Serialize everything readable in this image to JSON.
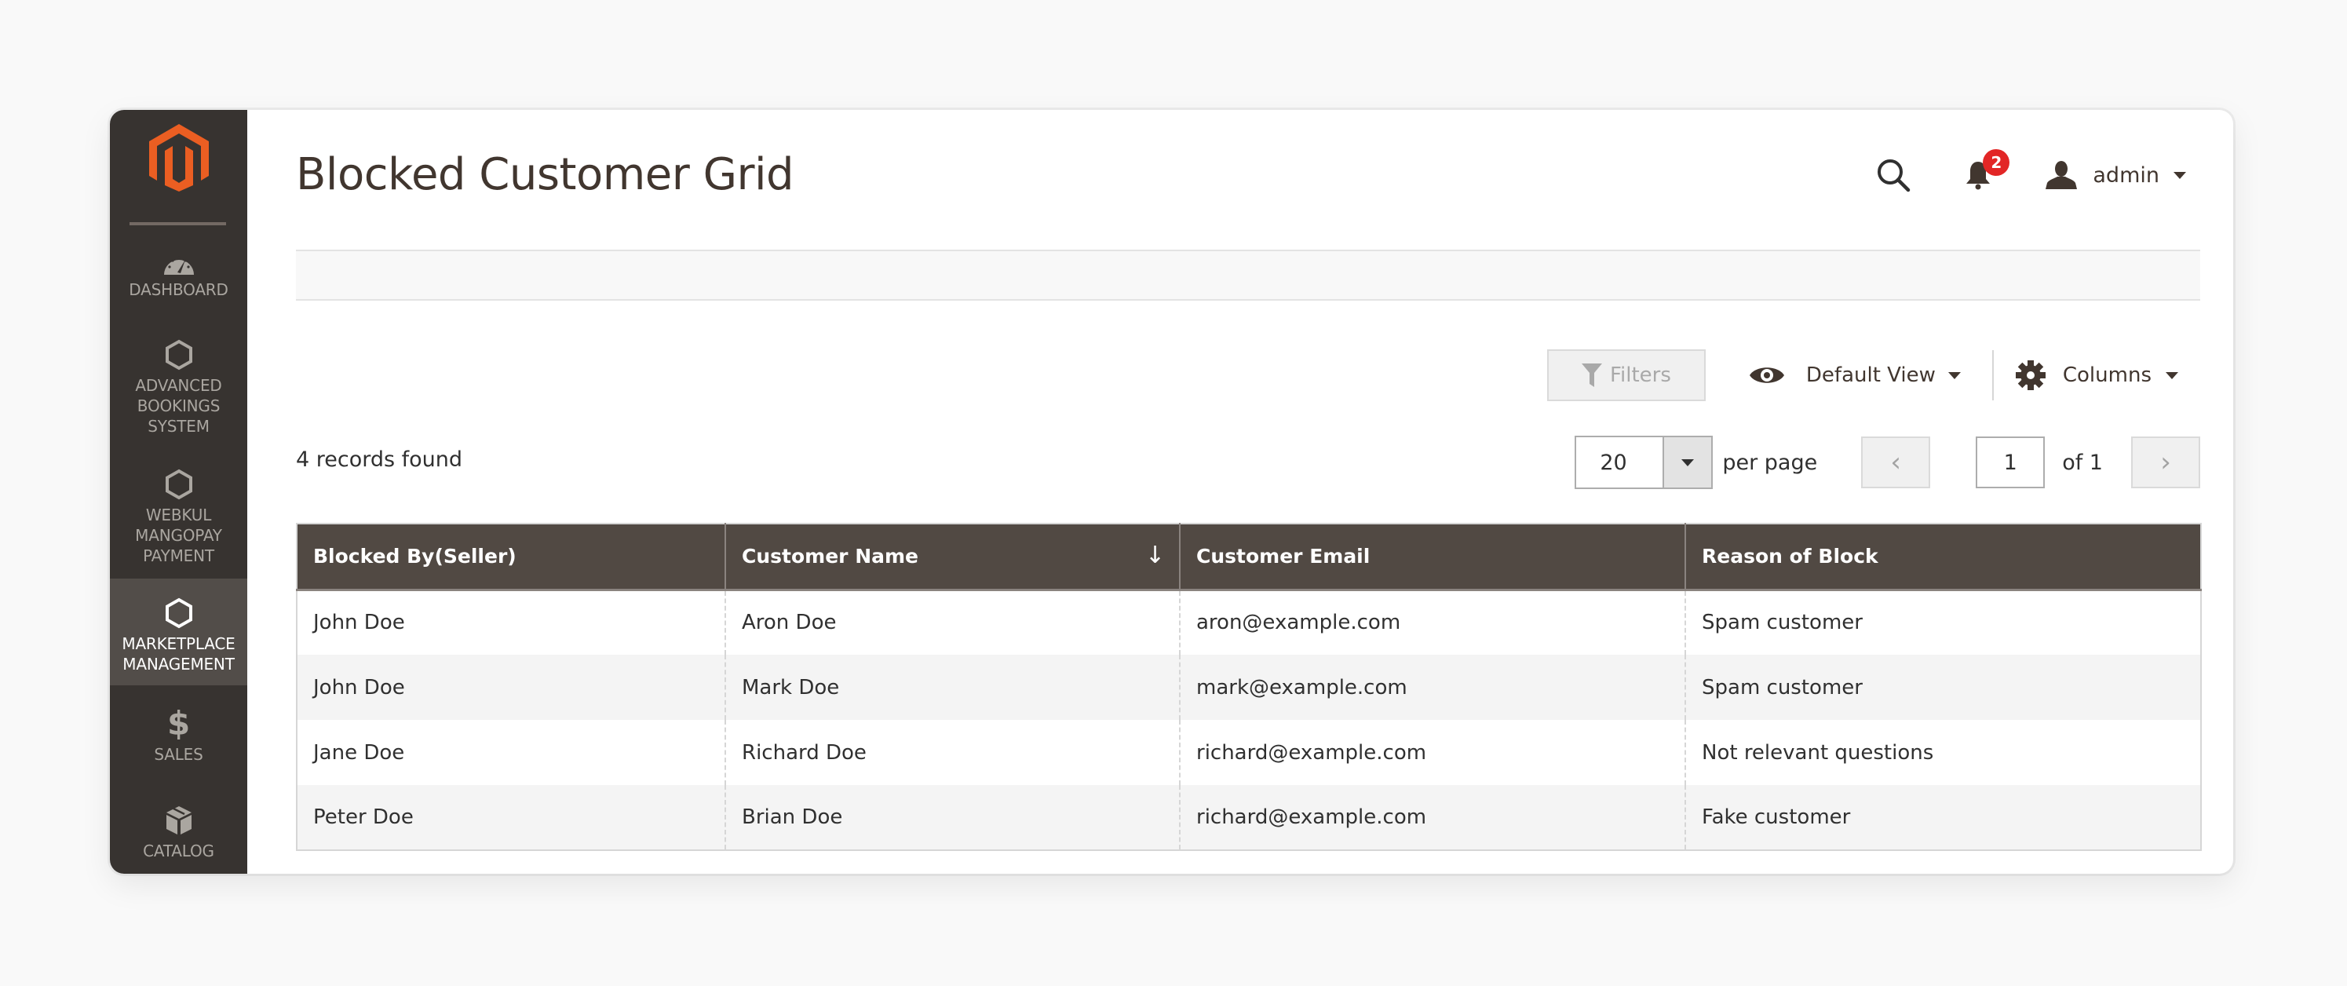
{
  "brand": {
    "logo": "magento-logo-icon",
    "accent": "#eb5202"
  },
  "sidebar": {
    "items": [
      {
        "icon": "dashboard-gauge-icon",
        "label": "DASHBOARD",
        "active": false
      },
      {
        "icon": "hexagon-icon",
        "label": "ADVANCED BOOKINGS SYSTEM",
        "lines": [
          "ADVANCED",
          "BOOKINGS",
          "SYSTEM"
        ],
        "active": false
      },
      {
        "icon": "hexagon-icon",
        "label": "WEBKUL MANGOPAY PAYMENT",
        "lines": [
          "WEBKUL",
          "MANGOPAY",
          "PAYMENT"
        ],
        "active": false
      },
      {
        "icon": "hexagon-icon",
        "label": "MARKETPLACE MANAGEMENT",
        "lines": [
          "MARKETPLACE",
          "MANAGEMENT"
        ],
        "active": true
      },
      {
        "icon": "dollar-icon",
        "label": "SALES",
        "lines": [
          "SALES"
        ],
        "active": false
      },
      {
        "icon": "catalog-box-icon",
        "label": "CATALOG",
        "lines": [
          "CATALOG"
        ],
        "active": false
      }
    ]
  },
  "header": {
    "title": "Blocked Customer Grid",
    "notifications_count": "2",
    "user": "admin"
  },
  "toolbar": {
    "filters_label": "Filters",
    "view_label": "Default View",
    "columns_label": "Columns"
  },
  "grid": {
    "records_found": "4 records found",
    "per_page_value": "20",
    "per_page_label": "per page",
    "current_page": "1",
    "page_of": "of 1",
    "columns": [
      "Blocked By(Seller)",
      "Customer Name",
      "Customer Email",
      "Reason of Block"
    ],
    "sorted_column": "Customer Name",
    "sort_direction": "descending",
    "rows": [
      [
        "John Doe",
        "Aron Doe",
        "aron@example.com",
        "Spam customer"
      ],
      [
        "John Doe",
        "Mark Doe",
        "mark@example.com",
        "Spam customer"
      ],
      [
        "Jane Doe",
        "Richard Doe",
        "richard@example.com",
        "Not relevant questions"
      ],
      [
        "Peter Doe",
        "Brian Doe",
        "richard@example.com",
        "Fake customer"
      ]
    ]
  },
  "colors": {
    "sidebar_bg": "#373330",
    "sidebar_active_bg": "#524d49",
    "table_header_bg": "#514943",
    "badge_red": "#e22626"
  }
}
